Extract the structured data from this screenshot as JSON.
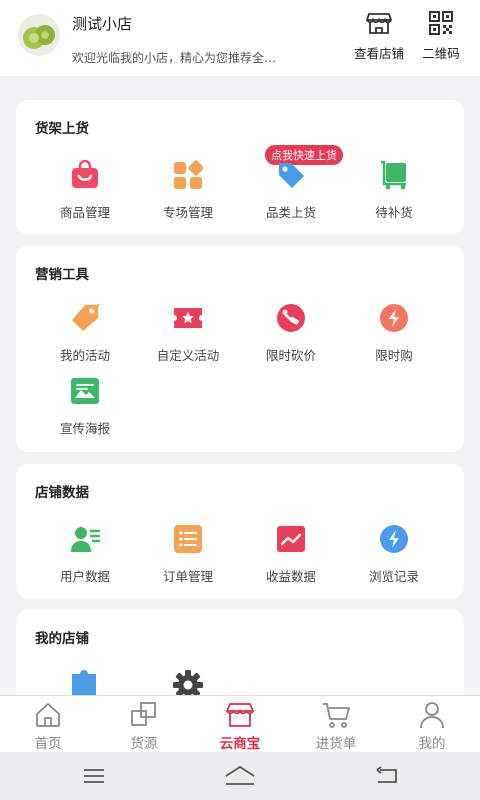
{
  "header": {
    "shop_name": "测试小店",
    "shop_desc": "欢迎光临我的小店，精心为您推荐全…",
    "view_store_label": "查看店铺",
    "qrcode_label": "二维码"
  },
  "sections": [
    {
      "title": "货架上货",
      "items": [
        {
          "label": "商品管理",
          "icon": "shopping-bag-icon",
          "color": "#f04a64"
        },
        {
          "label": "专场管理",
          "icon": "grid-icon",
          "color": "#f4a256"
        },
        {
          "label": "品类上货",
          "icon": "tag-icon",
          "color": "#4a9be8",
          "badge": "点我快速上货"
        },
        {
          "label": "待补货",
          "icon": "cart-icon",
          "color": "#3cb866"
        }
      ]
    },
    {
      "title": "营销工具",
      "items": [
        {
          "label": "我的活动",
          "icon": "tag-icon",
          "color": "#f4a256"
        },
        {
          "label": "自定义活动",
          "icon": "ticket-icon",
          "color": "#e8405a"
        },
        {
          "label": "限时砍价",
          "icon": "price-cut-icon",
          "color": "#e8405a"
        },
        {
          "label": "限时购",
          "icon": "flash-icon",
          "color": "#f47560"
        },
        {
          "label": "宣传海报",
          "icon": "poster-icon",
          "color": "#3cb866"
        }
      ]
    },
    {
      "title": "店铺数据",
      "items": [
        {
          "label": "用户数据",
          "icon": "user-card-icon",
          "color": "#3cb866"
        },
        {
          "label": "订单管理",
          "icon": "list-icon",
          "color": "#f4a256"
        },
        {
          "label": "收益数据",
          "icon": "trend-icon",
          "color": "#e8405a"
        },
        {
          "label": "浏览记录",
          "icon": "flash-icon",
          "color": "#4a9be8"
        }
      ]
    },
    {
      "title": "我的店铺",
      "items": [
        {
          "label": "",
          "icon": "puzzle-icon",
          "color": "#4a9be8"
        },
        {
          "label": "",
          "icon": "gear-icon",
          "color": "#444444"
        }
      ]
    }
  ],
  "tabs": [
    {
      "label": "首页",
      "icon": "home-icon",
      "active": false
    },
    {
      "label": "货源",
      "icon": "squares-icon",
      "active": false
    },
    {
      "label": "云商宝",
      "icon": "store-icon",
      "active": true
    },
    {
      "label": "进货单",
      "icon": "cart-icon",
      "active": false
    },
    {
      "label": "我的",
      "icon": "person-icon",
      "active": false
    }
  ],
  "colors": {
    "accent": "#d8324d",
    "badge": "#e23c55",
    "background": "#f3f3f5"
  }
}
